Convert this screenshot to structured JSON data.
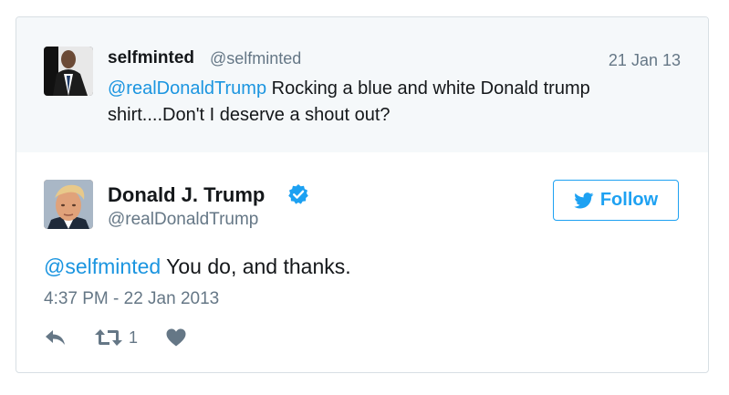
{
  "reply_context": {
    "name": "selfminted",
    "handle": "@selfminted",
    "date": "21 Jan 13",
    "mention": "@realDonaldTrump",
    "text": " Rocking a blue and white Donald trump shirt....Don't I deserve a shout out?"
  },
  "tweet": {
    "name": "Donald J. Trump",
    "handle": "@realDonaldTrump",
    "verified": true,
    "follow_label": "Follow",
    "mention": "@selfminted",
    "text": " You do, and thanks.",
    "timestamp": "4:37 PM - 22 Jan 2013",
    "actions": {
      "reply_icon": "reply-icon",
      "retweet_icon": "retweet-icon",
      "retweet_count": "1",
      "like_icon": "heart-icon"
    }
  },
  "colors": {
    "accent": "#1da1f2",
    "mention": "#1b95e0",
    "muted": "#657786",
    "context_bg": "#f5f8fa",
    "border": "#d8dfe4"
  }
}
